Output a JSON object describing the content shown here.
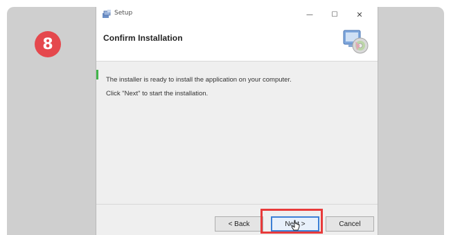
{
  "step": {
    "number": "8"
  },
  "window": {
    "title": "Setup",
    "controls": {
      "minimize": "—",
      "maximize": "☐",
      "close": "✕"
    }
  },
  "header": {
    "title": "Confirm Installation"
  },
  "body": {
    "line1": "The installer is ready to install the application on your computer.",
    "line2": "Click \"Next\" to start the installation."
  },
  "buttons": {
    "back": "< Back",
    "next": "Next >",
    "cancel": "Cancel"
  },
  "colors": {
    "badge": "#e5484d",
    "highlight": "#e83a3a",
    "focus": "#3c7fd6",
    "progress": "#41b54a"
  }
}
